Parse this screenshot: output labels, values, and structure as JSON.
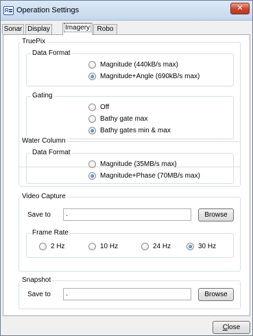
{
  "window": {
    "title": "Operation Settings",
    "app_icon_text": "R",
    "close_glyph": "✕"
  },
  "tabs": [
    {
      "label": "Sonar"
    },
    {
      "label": "Display"
    },
    {
      "label": "Imagery"
    },
    {
      "label": "Robo"
    }
  ],
  "truepix": {
    "title": "TruePix",
    "data_format": {
      "title": "Data Format",
      "options": [
        {
          "label": "Magnitude (440kB/s max)",
          "checked": false
        },
        {
          "label": "Magnitude+Angle (690kB/s max)",
          "checked": true
        }
      ]
    },
    "gating": {
      "title": "Gating",
      "options": [
        {
          "label": "Off",
          "checked": false
        },
        {
          "label": "Bathy gate max",
          "checked": false
        },
        {
          "label": "Bathy gates min & max",
          "checked": true
        }
      ]
    }
  },
  "water_column": {
    "title": "Water Column",
    "data_format": {
      "title": "Data Format",
      "options": [
        {
          "label": "Magnitude (35MB/s max)",
          "checked": false
        },
        {
          "label": "Magnitude+Phase (70MB/s max)",
          "checked": true
        }
      ]
    }
  },
  "video_capture": {
    "title": "Video Capture",
    "save_to_label": "Save to",
    "save_to_value": ".",
    "browse_label": "Browse",
    "frame_rate": {
      "title": "Frame Rate",
      "options": [
        {
          "label": "2 Hz",
          "checked": false
        },
        {
          "label": "10 Hz",
          "checked": false
        },
        {
          "label": "24 Hz",
          "checked": false
        },
        {
          "label": "30 Hz",
          "checked": true
        }
      ]
    }
  },
  "snapshot": {
    "title": "Snapshot",
    "save_to_label": "Save to",
    "save_to_value": ".",
    "browse_label": "Browse"
  },
  "footer": {
    "close_label_first": "C",
    "close_label_rest": "lose"
  }
}
